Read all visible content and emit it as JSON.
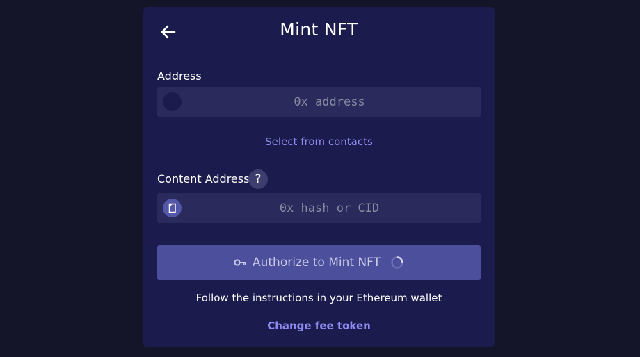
{
  "header": {
    "title": "Mint NFT"
  },
  "address_field": {
    "label": "Address",
    "placeholder": "0x address",
    "value": ""
  },
  "contacts_link": "Select from contacts",
  "content_field": {
    "label": "Content Address",
    "help_glyph": "?",
    "placeholder": "0x hash or CID",
    "value": ""
  },
  "authorize_button": {
    "label": "Authorize to Mint NFT",
    "icon": "key-icon",
    "loading": true
  },
  "instructions": "Follow the instructions in your Ethereum wallet",
  "fee_link": "Change fee token",
  "colors": {
    "background": "#15152a",
    "card": "#1b1b4d",
    "input": "#2a2a5c",
    "accent_link": "#8c8cf2",
    "button": "#4c4f9c"
  }
}
